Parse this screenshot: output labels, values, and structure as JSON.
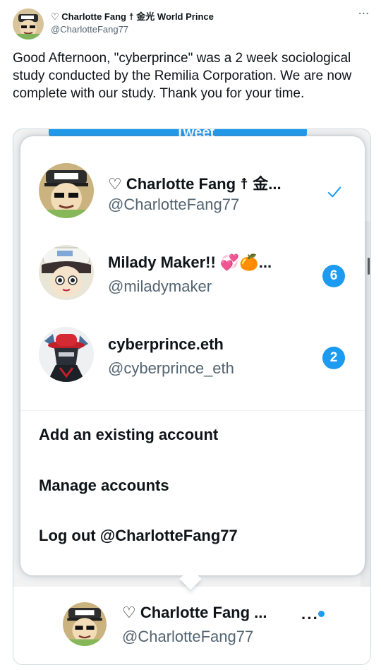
{
  "tweet": {
    "author_name": "♡ Charlotte Fang ☨ 金光 World Prince",
    "author_handle": "@CharlotteFang77",
    "more_icon": "⋯",
    "text": "Good Afternoon, \"cyberprince\" was a 2 week sociological study conducted by the Remilia Corporation. We are now complete with our study. Thank you for your time."
  },
  "screenshot": {
    "background_button_label": "Tweet",
    "accounts": [
      {
        "name": "♡ Charlotte Fang ☨ 金...",
        "handle": "@CharlotteFang77",
        "status_icon": "check-icon"
      },
      {
        "name": "Milady Maker!! 💞🍊...",
        "handle": "@miladymaker",
        "badge": "6"
      },
      {
        "name": "cyberprince.eth",
        "handle": "@cyberprince_eth",
        "badge": "2"
      }
    ],
    "menu": {
      "add_account": "Add an existing account",
      "manage_accounts": "Manage accounts",
      "logout": "Log out @CharlotteFang77"
    },
    "bottom_account": {
      "name": "♡ Charlotte Fang ...",
      "handle": "@CharlotteFang77",
      "more_icon": "···"
    }
  },
  "colors": {
    "accent": "#1d9bf0",
    "text_primary": "#0f1419",
    "text_secondary": "#536471",
    "border": "#cfd9de"
  }
}
